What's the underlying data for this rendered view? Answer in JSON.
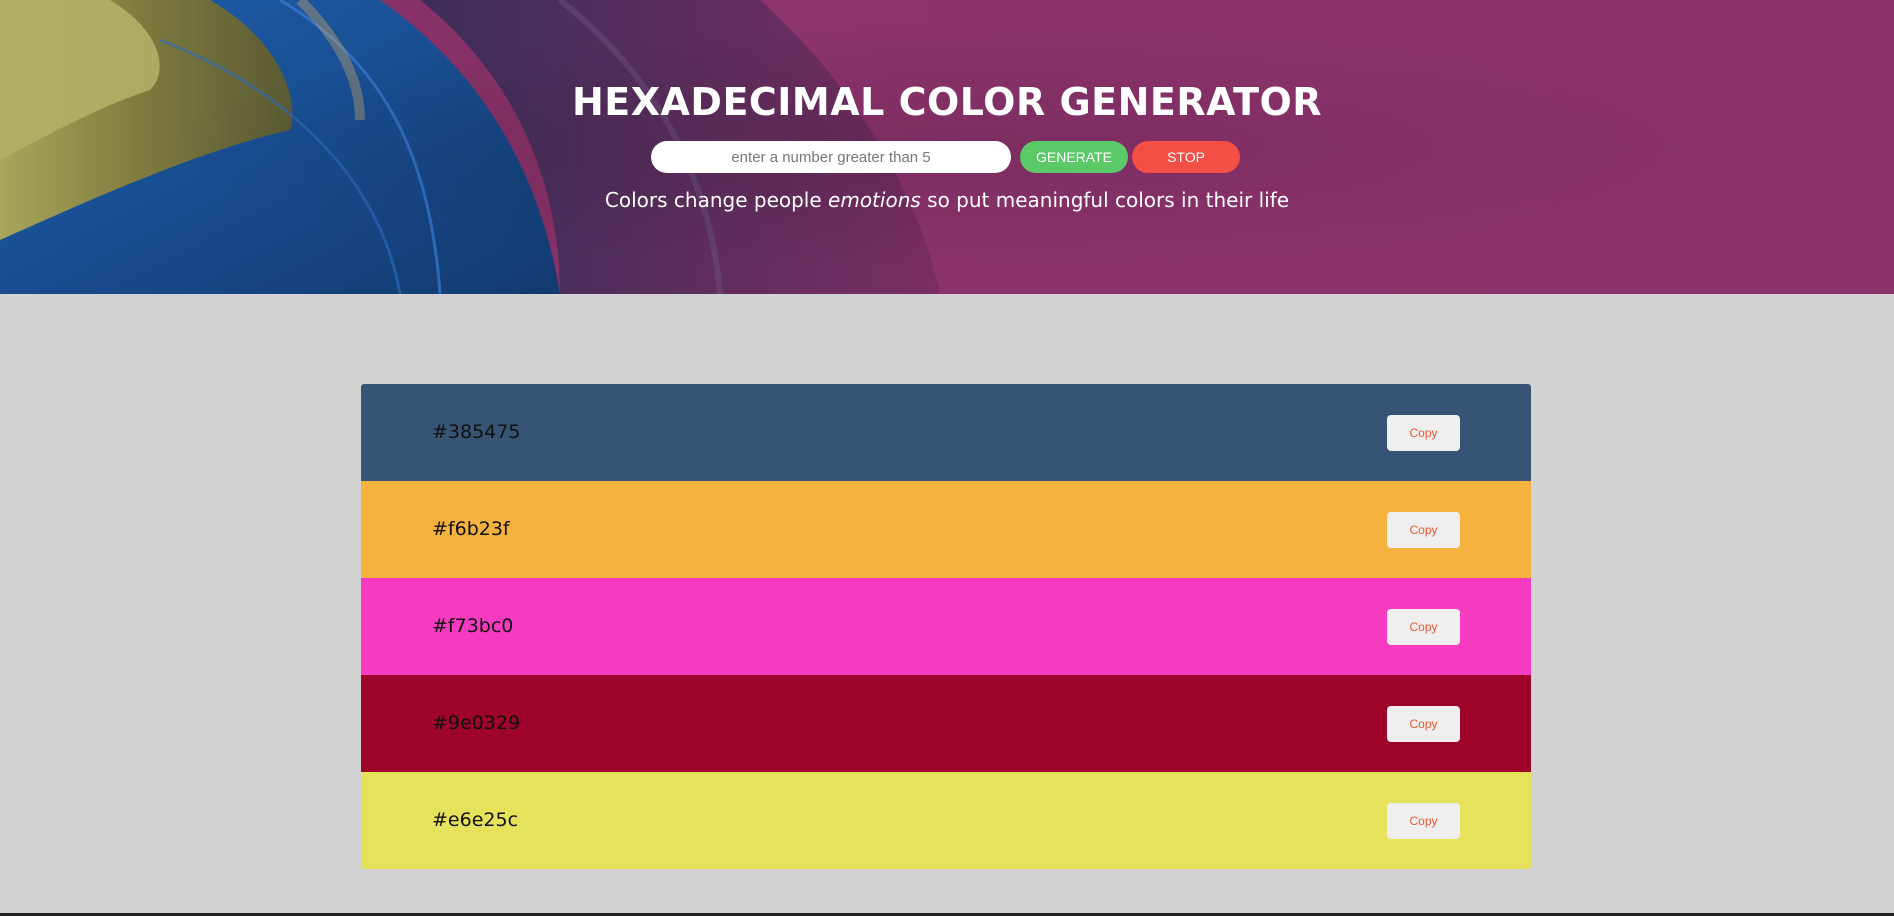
{
  "header": {
    "title": "HEXADECIMAL COLOR GENERATOR",
    "input": {
      "placeholder": "enter a number greater than 5",
      "value": ""
    },
    "generate_label": "GENERATE",
    "stop_label": "STOP",
    "tagline": {
      "before": "Colors change people ",
      "emphasis": "emotions",
      "after": " so put meaningful colors in their life"
    }
  },
  "colors": [
    {
      "code": "#385475",
      "hex": "#385475",
      "copy_label": "Copy"
    },
    {
      "code": "#f6b23f",
      "hex": "#f6b23f",
      "copy_label": "Copy"
    },
    {
      "code": "#f73bc0",
      "hex": "#f73bc0",
      "copy_label": "Copy"
    },
    {
      "code": "#9e0329",
      "hex": "#9e0329",
      "copy_label": "Copy"
    },
    {
      "code": "#e6e25c",
      "hex": "#e6e25c",
      "copy_label": "Copy"
    }
  ],
  "theme": {
    "page_background": "#d3d3d3",
    "generate_color": "#5cc968",
    "stop_color": "#f44f44",
    "copy_text_color": "#e8572e"
  }
}
